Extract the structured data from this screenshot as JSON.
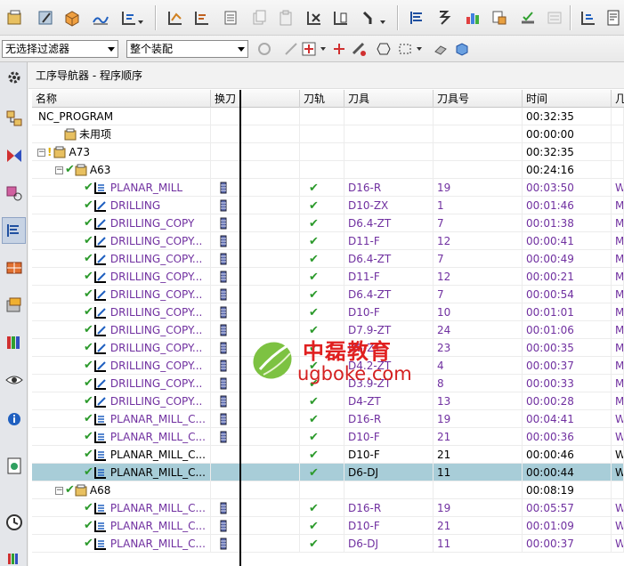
{
  "toolbar2": {
    "filter": "无选择过滤器",
    "assembly": "整个装配"
  },
  "navigator": {
    "title": "工序导航器 - 程序顺序",
    "columns": [
      "名称",
      "换刀",
      "刀轨",
      "刀具",
      "刀具号",
      "时间",
      "几"
    ]
  },
  "rows": [
    {
      "name": "NC_PROGRAM",
      "tool": "",
      "num": "",
      "time": "00:32:35",
      "extra": "",
      "kind": "root"
    },
    {
      "name": "未用项",
      "tool": "",
      "num": "",
      "time": "00:00:00",
      "extra": "",
      "kind": "group"
    },
    {
      "name": "A73",
      "tool": "",
      "num": "",
      "time": "00:32:35",
      "extra": "",
      "kind": "program"
    },
    {
      "name": "A63",
      "tool": "",
      "num": "",
      "time": "00:24:16",
      "extra": "",
      "kind": "program"
    },
    {
      "name": "PLANAR_MILL",
      "tool": "D16-R",
      "num": "19",
      "time": "00:03:50",
      "extra": "W",
      "kind": "op"
    },
    {
      "name": "DRILLING",
      "tool": "D10-ZX",
      "num": "1",
      "time": "00:01:46",
      "extra": "M",
      "kind": "op"
    },
    {
      "name": "DRILLING_COPY",
      "tool": "D6.4-ZT",
      "num": "7",
      "time": "00:01:38",
      "extra": "M",
      "kind": "op"
    },
    {
      "name": "DRILLING_COPY...",
      "tool": "D11-F",
      "num": "12",
      "time": "00:00:41",
      "extra": "M",
      "kind": "op"
    },
    {
      "name": "DRILLING_COPY...",
      "tool": "D6.4-ZT",
      "num": "7",
      "time": "00:00:49",
      "extra": "M",
      "kind": "op"
    },
    {
      "name": "DRILLING_COPY...",
      "tool": "D11-F",
      "num": "12",
      "time": "00:00:21",
      "extra": "M",
      "kind": "op"
    },
    {
      "name": "DRILLING_COPY...",
      "tool": "D6.4-ZT",
      "num": "7",
      "time": "00:00:54",
      "extra": "M",
      "kind": "op"
    },
    {
      "name": "DRILLING_COPY...",
      "tool": "D10-F",
      "num": "10",
      "time": "00:01:01",
      "extra": "M",
      "kind": "op"
    },
    {
      "name": "DRILLING_COPY...",
      "tool": "D7.9-ZT",
      "num": "24",
      "time": "00:01:06",
      "extra": "M",
      "kind": "op"
    },
    {
      "name": "DRILLING_COPY...",
      "tool": "D8-ZT",
      "num": "23",
      "time": "00:00:35",
      "extra": "M",
      "kind": "op"
    },
    {
      "name": "DRILLING_COPY...",
      "tool": "D4.2-ZT",
      "num": "4",
      "time": "00:00:37",
      "extra": "M",
      "kind": "op"
    },
    {
      "name": "DRILLING_COPY...",
      "tool": "D3.9-ZT",
      "num": "8",
      "time": "00:00:33",
      "extra": "M",
      "kind": "op"
    },
    {
      "name": "DRILLING_COPY...",
      "tool": "D4-ZT",
      "num": "13",
      "time": "00:00:28",
      "extra": "M",
      "kind": "op"
    },
    {
      "name": "PLANAR_MILL_C...",
      "tool": "D16-R",
      "num": "19",
      "time": "00:04:41",
      "extra": "W",
      "kind": "op"
    },
    {
      "name": "PLANAR_MILL_C...",
      "tool": "D10-F",
      "num": "21",
      "time": "00:00:36",
      "extra": "W",
      "kind": "op"
    },
    {
      "name": "PLANAR_MILL_C...",
      "tool": "D10-F",
      "num": "21",
      "time": "00:00:46",
      "extra": "W",
      "kind": "op-black"
    },
    {
      "name": "PLANAR_MILL_C...",
      "tool": "D6-DJ",
      "num": "11",
      "time": "00:00:44",
      "extra": "W",
      "kind": "op-selected"
    },
    {
      "name": "A68",
      "tool": "",
      "num": "",
      "time": "00:08:19",
      "extra": "",
      "kind": "program"
    },
    {
      "name": "PLANAR_MILL_C...",
      "tool": "D16-R",
      "num": "19",
      "time": "00:05:57",
      "extra": "W",
      "kind": "op"
    },
    {
      "name": "PLANAR_MILL_C...",
      "tool": "D10-F",
      "num": "21",
      "time": "00:01:09",
      "extra": "W",
      "kind": "op"
    },
    {
      "name": "PLANAR_MILL_C...",
      "tool": "D6-DJ",
      "num": "11",
      "time": "00:00:37",
      "extra": "W",
      "kind": "op"
    }
  ],
  "watermark": {
    "brand": "中磊教育",
    "url": "ugboke.com"
  },
  "colors": {
    "operation_text": "#7030a0",
    "selection": "#a8cdd8",
    "check": "#2c9a2c",
    "watermark": "#e02020"
  }
}
